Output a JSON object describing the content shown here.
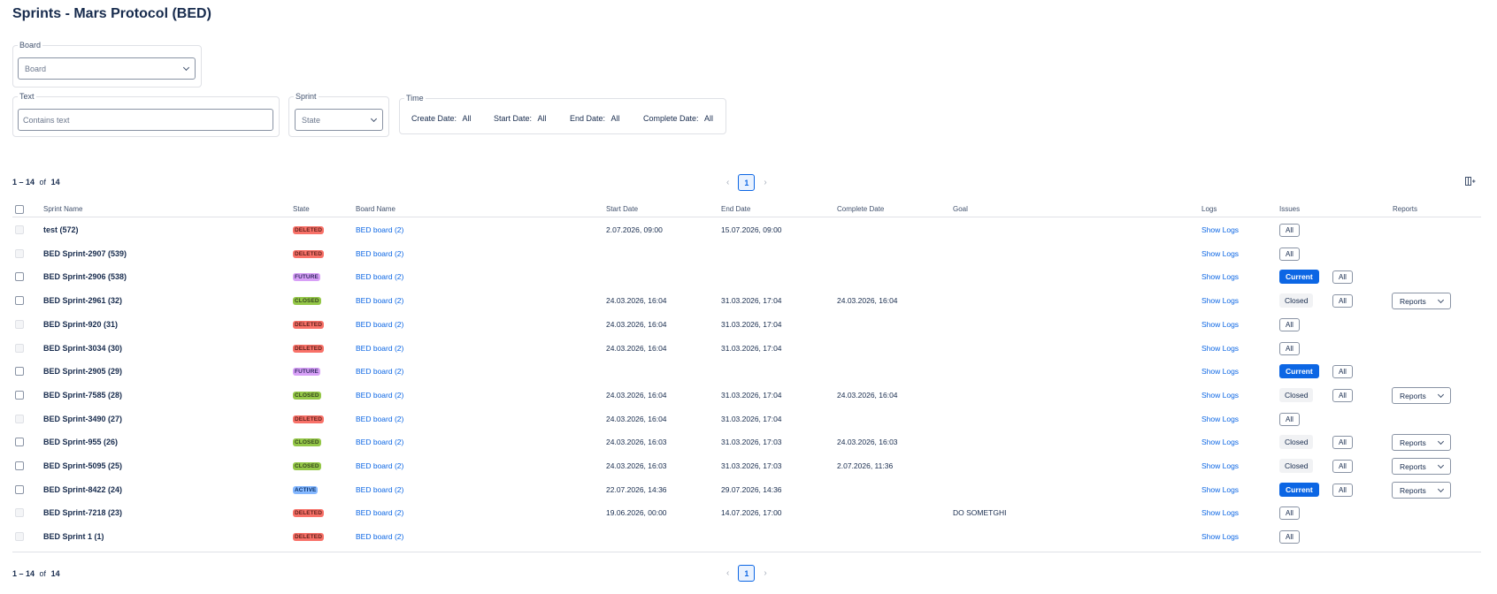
{
  "page": {
    "title": "Sprints - Mars Protocol (BED)"
  },
  "filters": {
    "board": {
      "legend": "Board",
      "placeholder": "Board"
    },
    "text": {
      "legend": "Text",
      "placeholder": "Contains text"
    },
    "sprint": {
      "legend": "Sprint",
      "placeholder": "State"
    },
    "time": {
      "legend": "Time",
      "create_label": "Create Date:",
      "create_value": "All",
      "start_label": "Start Date:",
      "start_value": "All",
      "end_label": "End Date:",
      "end_value": "All",
      "complete_label": "Complete Date:",
      "complete_value": "All"
    }
  },
  "pagination": {
    "range": "1 – 14",
    "of_label": "of",
    "total": "14",
    "current_page": "1"
  },
  "table": {
    "headers": {
      "sprint_name": "Sprint Name",
      "state": "State",
      "board_name": "Board Name",
      "start_date": "Start Date",
      "end_date": "End Date",
      "complete_date": "Complete Date",
      "goal": "Goal",
      "logs": "Logs",
      "issues": "Issues",
      "reports": "Reports"
    },
    "labels": {
      "show_logs": "Show Logs",
      "all": "All",
      "current": "Current",
      "closed": "Closed",
      "reports": "Reports"
    },
    "rows": [
      {
        "name": "test (572)",
        "state": "DELETED",
        "board": "BED board (2)",
        "start": "2.07.2026, 09:00",
        "end": "15.07.2026, 09:00",
        "complete": "",
        "goal": "",
        "issues": "all",
        "reports": false
      },
      {
        "name": "BED Sprint-2907 (539)",
        "state": "DELETED",
        "board": "BED board (2)",
        "start": "",
        "end": "",
        "complete": "",
        "goal": "",
        "issues": "all",
        "reports": false
      },
      {
        "name": "BED Sprint-2906 (538)",
        "state": "FUTURE",
        "board": "BED board (2)",
        "start": "",
        "end": "",
        "complete": "",
        "goal": "",
        "issues": "current",
        "reports": false
      },
      {
        "name": "BED Sprint-2961 (32)",
        "state": "CLOSED",
        "board": "BED board (2)",
        "start": "24.03.2026, 16:04",
        "end": "31.03.2026, 17:04",
        "complete": "24.03.2026, 16:04",
        "goal": "",
        "issues": "closed",
        "reports": true
      },
      {
        "name": "BED Sprint-920 (31)",
        "state": "DELETED",
        "board": "BED board (2)",
        "start": "24.03.2026, 16:04",
        "end": "31.03.2026, 17:04",
        "complete": "",
        "goal": "",
        "issues": "all",
        "reports": false
      },
      {
        "name": "BED Sprint-3034 (30)",
        "state": "DELETED",
        "board": "BED board (2)",
        "start": "24.03.2026, 16:04",
        "end": "31.03.2026, 17:04",
        "complete": "",
        "goal": "",
        "issues": "all",
        "reports": false
      },
      {
        "name": "BED Sprint-2905 (29)",
        "state": "FUTURE",
        "board": "BED board (2)",
        "start": "",
        "end": "",
        "complete": "",
        "goal": "",
        "issues": "current",
        "reports": false
      },
      {
        "name": "BED Sprint-7585 (28)",
        "state": "CLOSED",
        "board": "BED board (2)",
        "start": "24.03.2026, 16:04",
        "end": "31.03.2026, 17:04",
        "complete": "24.03.2026, 16:04",
        "goal": "",
        "issues": "closed",
        "reports": true
      },
      {
        "name": "BED Sprint-3490 (27)",
        "state": "DELETED",
        "board": "BED board (2)",
        "start": "24.03.2026, 16:04",
        "end": "31.03.2026, 17:04",
        "complete": "",
        "goal": "",
        "issues": "all",
        "reports": false
      },
      {
        "name": "BED Sprint-955 (26)",
        "state": "CLOSED",
        "board": "BED board (2)",
        "start": "24.03.2026, 16:03",
        "end": "31.03.2026, 17:03",
        "complete": "24.03.2026, 16:03",
        "goal": "",
        "issues": "closed",
        "reports": true
      },
      {
        "name": "BED Sprint-5095 (25)",
        "state": "CLOSED",
        "board": "BED board (2)",
        "start": "24.03.2026, 16:03",
        "end": "31.03.2026, 17:03",
        "complete": "2.07.2026, 11:36",
        "goal": "",
        "issues": "closed",
        "reports": true
      },
      {
        "name": "BED Sprint-8422 (24)",
        "state": "ACTIVE",
        "board": "BED board (2)",
        "start": "22.07.2026, 14:36",
        "end": "29.07.2026, 14:36",
        "complete": "",
        "goal": "",
        "issues": "current",
        "reports": true
      },
      {
        "name": "BED Sprint-7218 (23)",
        "state": "DELETED",
        "board": "BED board (2)",
        "start": "19.06.2026, 00:00",
        "end": "14.07.2026, 17:00",
        "complete": "",
        "goal": "DO SOMETGHI",
        "issues": "all",
        "reports": false
      },
      {
        "name": "BED Sprint 1 (1)",
        "state": "DELETED",
        "board": "BED board (2)",
        "start": "",
        "end": "",
        "complete": "",
        "goal": "",
        "issues": "all",
        "reports": false
      }
    ]
  }
}
